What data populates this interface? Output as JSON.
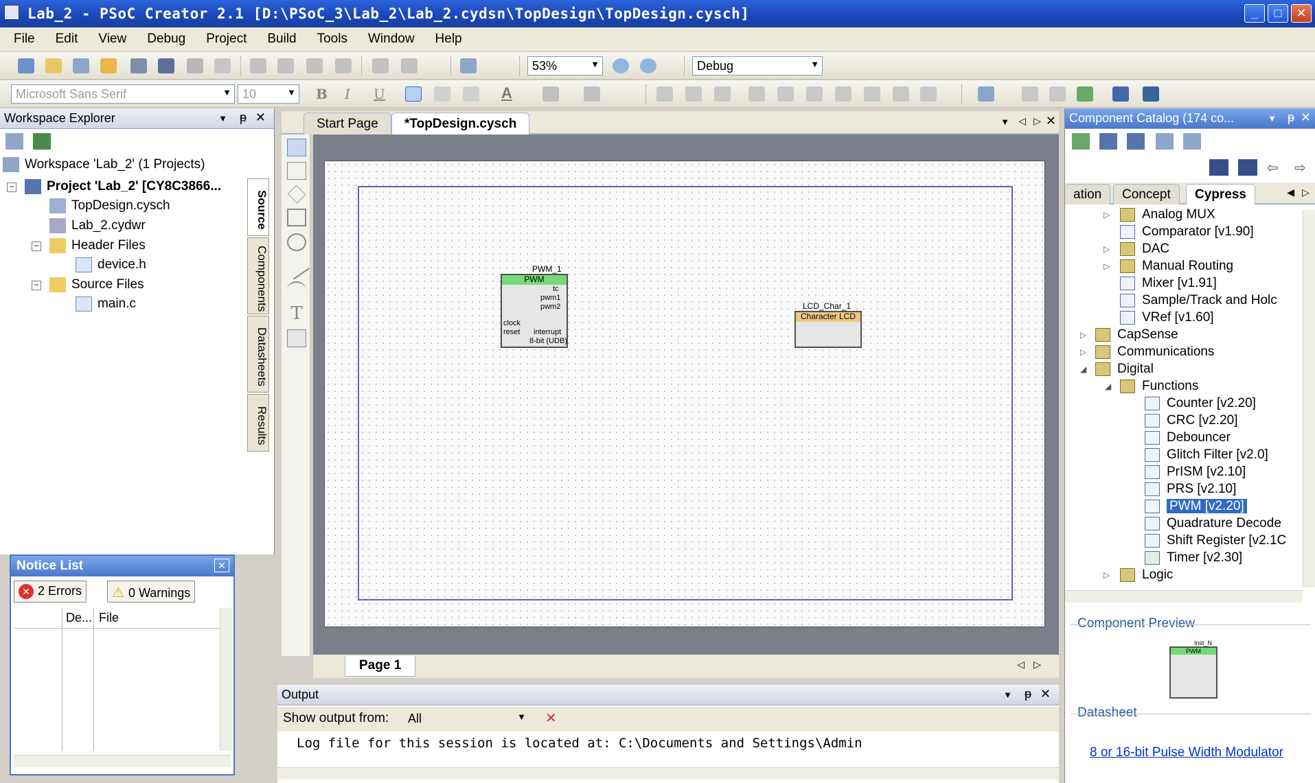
{
  "window": {
    "title": "Lab_2 - PSoC Creator 2.1  [D:\\PSoC_3\\Lab_2\\Lab_2.cydsn\\TopDesign\\TopDesign.cysch]",
    "minimize": "_",
    "maximize": "□",
    "close": "✕"
  },
  "menu": [
    "File",
    "Edit",
    "View",
    "Debug",
    "Project",
    "Build",
    "Tools",
    "Window",
    "Help"
  ],
  "toolbar1": {
    "zoom": "53%",
    "config": "Debug"
  },
  "toolbar2": {
    "font": "Microsoft Sans Serif",
    "size": "10",
    "bold": "B",
    "italic": "I",
    "underline": "U",
    "text_color": "A"
  },
  "workspace": {
    "title": "Workspace Explorer",
    "pin": "ᵽ",
    "close": "✕",
    "items": [
      {
        "label": "Workspace 'Lab_2' (1 Projects)"
      },
      {
        "label": "Project 'Lab_2' [CY8C3866..."
      },
      {
        "label": "TopDesign.cysch"
      },
      {
        "label": "Lab_2.cydwr"
      },
      {
        "label": "Header Files"
      },
      {
        "label": "device.h"
      },
      {
        "label": "Source Files"
      },
      {
        "label": "main.c"
      }
    ],
    "side_tabs": [
      "Source",
      "Components",
      "Datasheets",
      "Results"
    ]
  },
  "notice": {
    "title": "Notice List",
    "errors": "2 Errors",
    "warnings": "0 Warnings",
    "columns": [
      "De...",
      "File"
    ]
  },
  "document": {
    "tabs": [
      "Start Page",
      "*TopDesign.cysch"
    ],
    "page_tab": "Page 1",
    "pwm": {
      "instance": "PWM_1",
      "type": "PWM",
      "pins": [
        "tc",
        "pwm1",
        "pwm2",
        "clock",
        "reset",
        "interrupt"
      ],
      "note": "8-bit (UDB)"
    },
    "lcd": {
      "instance": "LCD_Char_1",
      "type": "Character LCD"
    }
  },
  "output": {
    "title": "Output",
    "show_label": "Show output from:",
    "source": "All",
    "log": "Log file for this session is located at: C:\\Documents and Settings\\Admin"
  },
  "catalog": {
    "title": "Component Catalog (174 co...",
    "tabs": [
      "ation",
      "Concept",
      "Cypress"
    ],
    "items": [
      {
        "label": "Analog MUX"
      },
      {
        "label": "Comparator [v1.90]"
      },
      {
        "label": "DAC"
      },
      {
        "label": "Manual Routing"
      },
      {
        "label": "Mixer [v1.91]"
      },
      {
        "label": "Sample/Track and Holc"
      },
      {
        "label": "VRef [v1.60]"
      },
      {
        "label": "CapSense"
      },
      {
        "label": "Communications"
      },
      {
        "label": "Digital"
      },
      {
        "label": "Functions"
      },
      {
        "label": "Counter [v2.20]"
      },
      {
        "label": "CRC [v2.20]"
      },
      {
        "label": "Debouncer"
      },
      {
        "label": "Glitch Filter [v2.0]"
      },
      {
        "label": "PrISM [v2.10]"
      },
      {
        "label": "PRS [v2.10]"
      },
      {
        "label": "PWM [v2.20]"
      },
      {
        "label": "Quadrature Decode"
      },
      {
        "label": "Shift Register [v2.1C"
      },
      {
        "label": "Timer [v2.30]"
      },
      {
        "label": "Logic"
      }
    ]
  },
  "preview": {
    "title": "Component Preview",
    "datasheet_label": "Datasheet",
    "datasheet_link": "8 or 16-bit Pulse Width Modulator",
    "mini_instance": "Inst_N",
    "mini_type": "PWM"
  }
}
